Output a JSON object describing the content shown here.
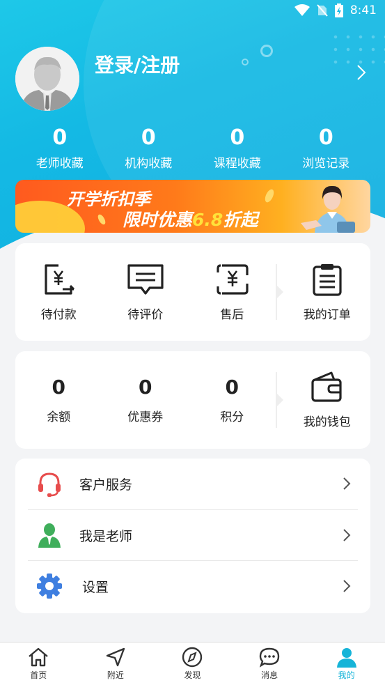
{
  "status_bar": {
    "time": "8:41"
  },
  "profile": {
    "login_label": "登录/注册"
  },
  "stats": [
    {
      "value": "0",
      "label": "老师收藏"
    },
    {
      "value": "0",
      "label": "机构收藏"
    },
    {
      "value": "0",
      "label": "课程收藏"
    },
    {
      "value": "0",
      "label": "浏览记录"
    }
  ],
  "banner": {
    "line1": "开学折扣季",
    "line2_prefix": "限时优惠",
    "line2_highlight": "6.8",
    "line2_suffix": "折起"
  },
  "orders": {
    "items": [
      {
        "label": "待付款",
        "icon": "payment-pending-icon"
      },
      {
        "label": "待评价",
        "icon": "review-pending-icon"
      },
      {
        "label": "售后",
        "icon": "after-sale-icon"
      }
    ],
    "all_label": "我的订单"
  },
  "wallet": {
    "items": [
      {
        "value": "0",
        "label": "余额"
      },
      {
        "value": "0",
        "label": "优惠券"
      },
      {
        "value": "0",
        "label": "积分"
      }
    ],
    "all_label": "我的钱包"
  },
  "menu": [
    {
      "label": "客户服务",
      "icon": "headset-icon"
    },
    {
      "label": "我是老师",
      "icon": "teacher-icon"
    },
    {
      "label": "设置",
      "icon": "gear-icon"
    }
  ],
  "tabbar": [
    {
      "label": "首页",
      "icon": "home-icon"
    },
    {
      "label": "附近",
      "icon": "navigation-icon"
    },
    {
      "label": "发现",
      "icon": "compass-icon"
    },
    {
      "label": "消息",
      "icon": "chat-icon"
    },
    {
      "label": "我的",
      "icon": "user-icon",
      "active": true
    }
  ],
  "colors": {
    "accent": "#16b4d8",
    "header": "#14b9e4",
    "banner": "#ff6a1f"
  }
}
